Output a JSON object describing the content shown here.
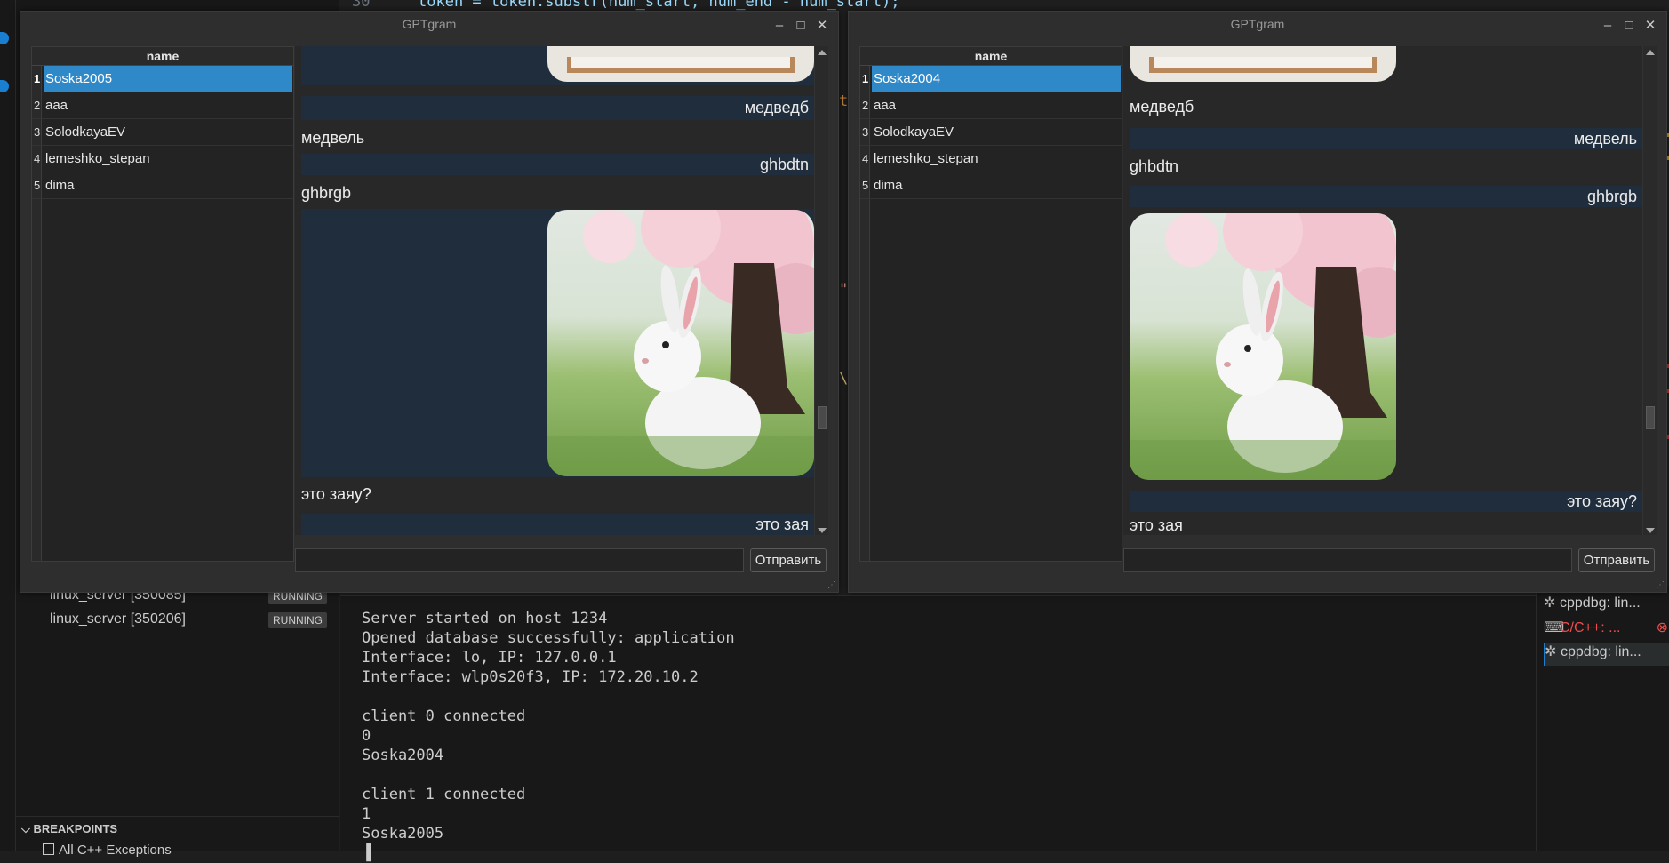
{
  "ide": {
    "code_line_number": "30",
    "code_fragment": "token = token.substr(num_start, num_end - num_start);",
    "processes": [
      {
        "name": "linux_server [350085]",
        "status": "RUNNING"
      },
      {
        "name": "linux_server [350206]",
        "status": "RUNNING"
      }
    ],
    "terminal_lines": "Server started on host 1234\nOpened database successfully: application\nInterface: lo, IP: 127.0.0.1\nInterface: wlp0s20f3, IP: 172.20.10.2\n\nclient 0 connected\n0\nSoska2004\n\nclient 1 connected\n1\nSoska2005\n▐",
    "terminal_tabs": [
      {
        "icon": "bug-icon",
        "label": "cppdbg: lin..."
      },
      {
        "icon": "terminal-icon",
        "label": "C/C++: ...",
        "error": true
      },
      {
        "icon": "bug-icon",
        "label": "cppdbg: lin..."
      }
    ],
    "breakpoints_title": "BREAKPOINTS",
    "breakpoint_item": "All C++ Exceptions"
  },
  "win_left": {
    "title": "GPTgram",
    "column_header": "name",
    "users": [
      {
        "num": "1",
        "name": "Soska2005",
        "selected": true
      },
      {
        "num": "2",
        "name": "aaa"
      },
      {
        "num": "3",
        "name": "SolodkayaEV"
      },
      {
        "num": "4",
        "name": "lemeshko_stepan"
      },
      {
        "num": "5",
        "name": "dima"
      }
    ],
    "messages": {
      "m1": "медведб",
      "m2": "медвель",
      "m3": "ghbdtn",
      "m4": "ghbrgb",
      "m5": "это заяу?",
      "m6": "это зая"
    },
    "input_value": "",
    "send_label": "Отправить"
  },
  "win_right": {
    "title": "GPTgram",
    "column_header": "name",
    "users": [
      {
        "num": "1",
        "name": "Soska2004",
        "selected": true
      },
      {
        "num": "2",
        "name": "aaa"
      },
      {
        "num": "3",
        "name": "SolodkayaEV"
      },
      {
        "num": "4",
        "name": "lemeshko_stepan"
      },
      {
        "num": "5",
        "name": "dima"
      }
    ],
    "messages": {
      "m1": "медведб",
      "m2": "медвель",
      "m3": "ghbdtn",
      "m4": "ghbrgb",
      "m5": "это заяу?",
      "m6": "это зая"
    },
    "input_value": "",
    "send_label": "Отправить"
  },
  "colors": {
    "selection": "#2f88c8",
    "outgoing_bubble": "#1f2d3d",
    "accent_blue": "#1b7fd1",
    "error_red": "#f14c4c"
  }
}
